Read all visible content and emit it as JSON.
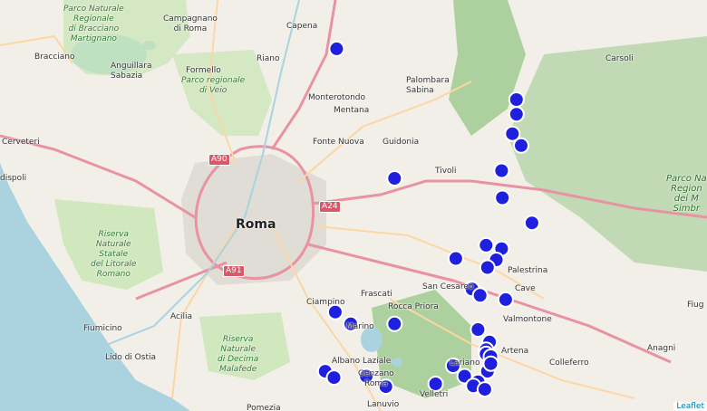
{
  "map": {
    "attribution": "Leaflet",
    "colors": {
      "land": "#f2efe9",
      "sea": "#aad3df",
      "park": "#c8e6b4",
      "forest": "#add19e",
      "urban": "#e0dcd6",
      "motorway": "#e892a2",
      "primary": "#fcd6a4",
      "marker_fill": "#1f1fe0",
      "marker_stroke": "#ffffff"
    },
    "labels": {
      "roma": "Roma",
      "campagnano": "Campagnano\ndi Roma",
      "capena": "Capena",
      "riano": "Riano",
      "bracciano": "Bracciano",
      "anguillara": "Anguillara\nSabazia",
      "formello": "Formello",
      "monterotondo": "Monterotondo",
      "mentana": "Mentana",
      "fonte_nuova": "Fonte Nuova",
      "guidonia": "Guidonia",
      "palombara": "Palombara\nSabina",
      "tivoli": "Tivoli",
      "carsoli": "Carsoli",
      "cerveteri": "Cerveteri",
      "ladispoli": "dispoli",
      "palestrina": "Palestrina",
      "cave": "Cave",
      "san_cesareo": "San Cesareo",
      "frascati": "Frascati",
      "rocca_priora": "Rocca Priora",
      "valmontone": "Valmontone",
      "ciampino": "Ciampino",
      "marino": "Marino",
      "acilia": "Acilia",
      "fiumicino": "Fiumicino",
      "lido": "Lido di Ostia",
      "albano": "Albano Laziale",
      "genzano": "Genzano\nRoma",
      "lariano": "Lariano",
      "artena": "Artena",
      "colleferro": "Colleferro",
      "anagni": "Anagni",
      "velletri": "Velletri",
      "lanuvio": "Lanuvio",
      "pomezia": "Pomezia",
      "fiuggi": "Fiug",
      "parco_bracciano": "Parco Naturale\nRegionale\ndi Bracciano\nMartignano",
      "parco_veio": "Parco regionale\ndi Veio",
      "riserva_litorale": "Riserva\nNaturale\nStatale\ndel Litorale\nRomano",
      "riserva_decima": "Riserva\nNaturale\ndi Decima\nMalafede",
      "parco_simbruini": "Parco Na\nRegion\ndei M\nSimbr"
    },
    "roads": {
      "a90": "A90",
      "a24": "A24",
      "a91": "A91"
    },
    "markers": [
      {
        "lat": 42.1,
        "lon": 12.5
      },
      {
        "lat": 42.027,
        "lon": 12.767
      },
      {
        "lat": 42.006,
        "lon": 12.767
      },
      {
        "lat": 41.978,
        "lon": 12.761
      },
      {
        "lat": 41.961,
        "lon": 12.774
      },
      {
        "lat": 41.925,
        "lon": 12.745
      },
      {
        "lat": 41.886,
        "lon": 12.746
      },
      {
        "lat": 41.85,
        "lon": 12.79
      },
      {
        "lat": 41.914,
        "lon": 12.586
      },
      {
        "lat": 41.818,
        "lon": 12.722
      },
      {
        "lat": 41.813,
        "lon": 12.745
      },
      {
        "lat": 41.799,
        "lon": 12.677
      },
      {
        "lat": 41.797,
        "lon": 12.737
      },
      {
        "lat": 41.786,
        "lon": 12.724
      },
      {
        "lat": 41.755,
        "lon": 12.701
      },
      {
        "lat": 41.746,
        "lon": 12.713
      },
      {
        "lat": 41.74,
        "lon": 12.751
      },
      {
        "lat": 41.697,
        "lon": 12.71
      },
      {
        "lat": 41.679,
        "lon": 12.727
      },
      {
        "lat": 41.668,
        "lon": 12.722
      },
      {
        "lat": 41.662,
        "lon": 12.722
      },
      {
        "lat": 41.658,
        "lon": 12.729
      },
      {
        "lat": 41.645,
        "lon": 12.673
      },
      {
        "lat": 41.63,
        "lon": 12.69
      },
      {
        "lat": 41.637,
        "lon": 12.724
      },
      {
        "lat": 41.648,
        "lon": 12.729
      },
      {
        "lat": 41.622,
        "lon": 12.71
      },
      {
        "lat": 41.619,
        "lon": 12.647
      },
      {
        "lat": 41.616,
        "lon": 12.703
      },
      {
        "lat": 41.611,
        "lon": 12.72
      },
      {
        "lat": 41.722,
        "lon": 12.498
      },
      {
        "lat": 41.705,
        "lon": 12.521
      },
      {
        "lat": 41.705,
        "lon": 12.586
      },
      {
        "lat": 41.637,
        "lon": 12.483
      },
      {
        "lat": 41.628,
        "lon": 12.496
      },
      {
        "lat": 41.63,
        "lon": 12.544
      },
      {
        "lat": 41.615,
        "lon": 12.573
      }
    ]
  }
}
